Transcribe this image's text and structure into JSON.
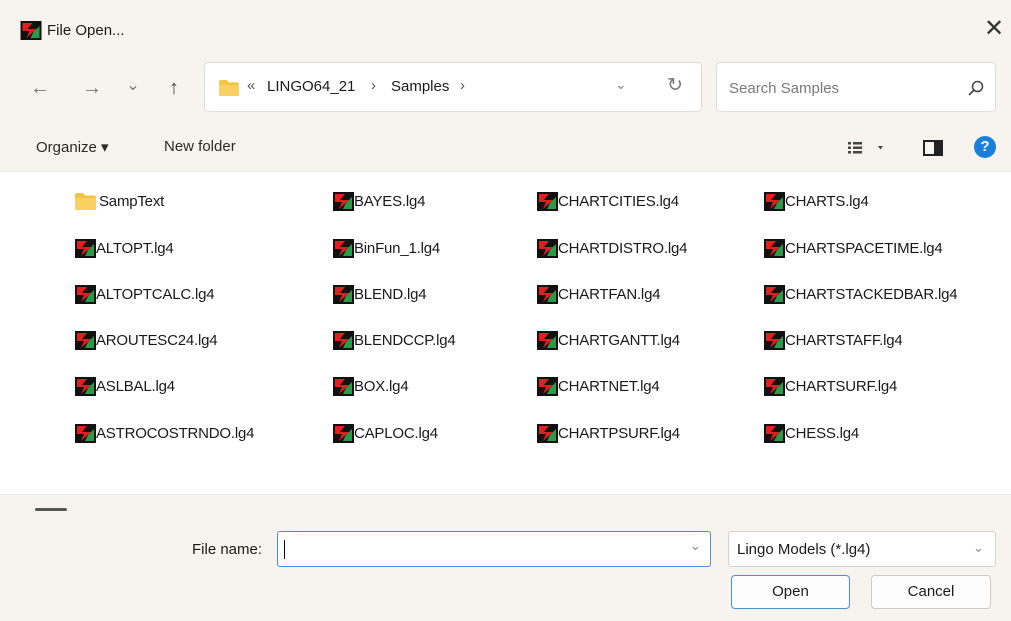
{
  "window": {
    "title": "File Open...",
    "close_glyph": "✕"
  },
  "nav": {
    "back_glyph": "←",
    "forward_glyph": "→",
    "recent_glyph": "⌄",
    "up_glyph": "↑"
  },
  "address": {
    "overflow_glyph": "«",
    "crumbs": [
      "LINGO64_21",
      "Samples"
    ],
    "separator": "›",
    "dropdown_glyph": "⌄",
    "refresh_glyph": "↻"
  },
  "search": {
    "placeholder": "Search Samples"
  },
  "toolbar": {
    "organize_label": "Organize ▾",
    "new_folder_label": "New folder",
    "help_glyph": "?"
  },
  "files": [
    {
      "name": "SampText",
      "type": "folder"
    },
    {
      "name": "ALTOPT.lg4",
      "type": "lingo"
    },
    {
      "name": "ALTOPTCALC.lg4",
      "type": "lingo"
    },
    {
      "name": "AROUTESC24.lg4",
      "type": "lingo"
    },
    {
      "name": "ASLBAL.lg4",
      "type": "lingo"
    },
    {
      "name": "ASTROCOSTRNDO.lg4",
      "type": "lingo"
    },
    {
      "name": "BAYES.lg4",
      "type": "lingo"
    },
    {
      "name": "BinFun_1.lg4",
      "type": "lingo"
    },
    {
      "name": "BLEND.lg4",
      "type": "lingo"
    },
    {
      "name": "BLENDCCP.lg4",
      "type": "lingo"
    },
    {
      "name": "BOX.lg4",
      "type": "lingo"
    },
    {
      "name": "CAPLOC.lg4",
      "type": "lingo"
    },
    {
      "name": "CHARTCITIES.lg4",
      "type": "lingo"
    },
    {
      "name": "CHARTDISTRO.lg4",
      "type": "lingo"
    },
    {
      "name": "CHARTFAN.lg4",
      "type": "lingo"
    },
    {
      "name": "CHARTGANTT.lg4",
      "type": "lingo"
    },
    {
      "name": "CHARTNET.lg4",
      "type": "lingo"
    },
    {
      "name": "CHARTPSURF.lg4",
      "type": "lingo"
    },
    {
      "name": "CHARTS.lg4",
      "type": "lingo"
    },
    {
      "name": "CHARTSPACETIME.lg4",
      "type": "lingo"
    },
    {
      "name": "CHARTSTACKEDBAR.lg4",
      "type": "lingo"
    },
    {
      "name": "CHARTSTAFF.lg4",
      "type": "lingo"
    },
    {
      "name": "CHARTSURF.lg4",
      "type": "lingo"
    },
    {
      "name": "CHESS.lg4",
      "type": "lingo"
    }
  ],
  "footer": {
    "file_name_label": "File name:",
    "file_name_value": "",
    "dropdown_glyph": "⌄",
    "file_type": "Lingo Models (*.lg4)",
    "open_label": "Open",
    "cancel_label": "Cancel"
  },
  "colors": {
    "chrome_bg": "#f7f3ee",
    "accent": "#4a8edc",
    "help_blue": "#1a7fd8",
    "folder_yellow": "#f5c242",
    "lingo_red": "#d81e1e"
  }
}
